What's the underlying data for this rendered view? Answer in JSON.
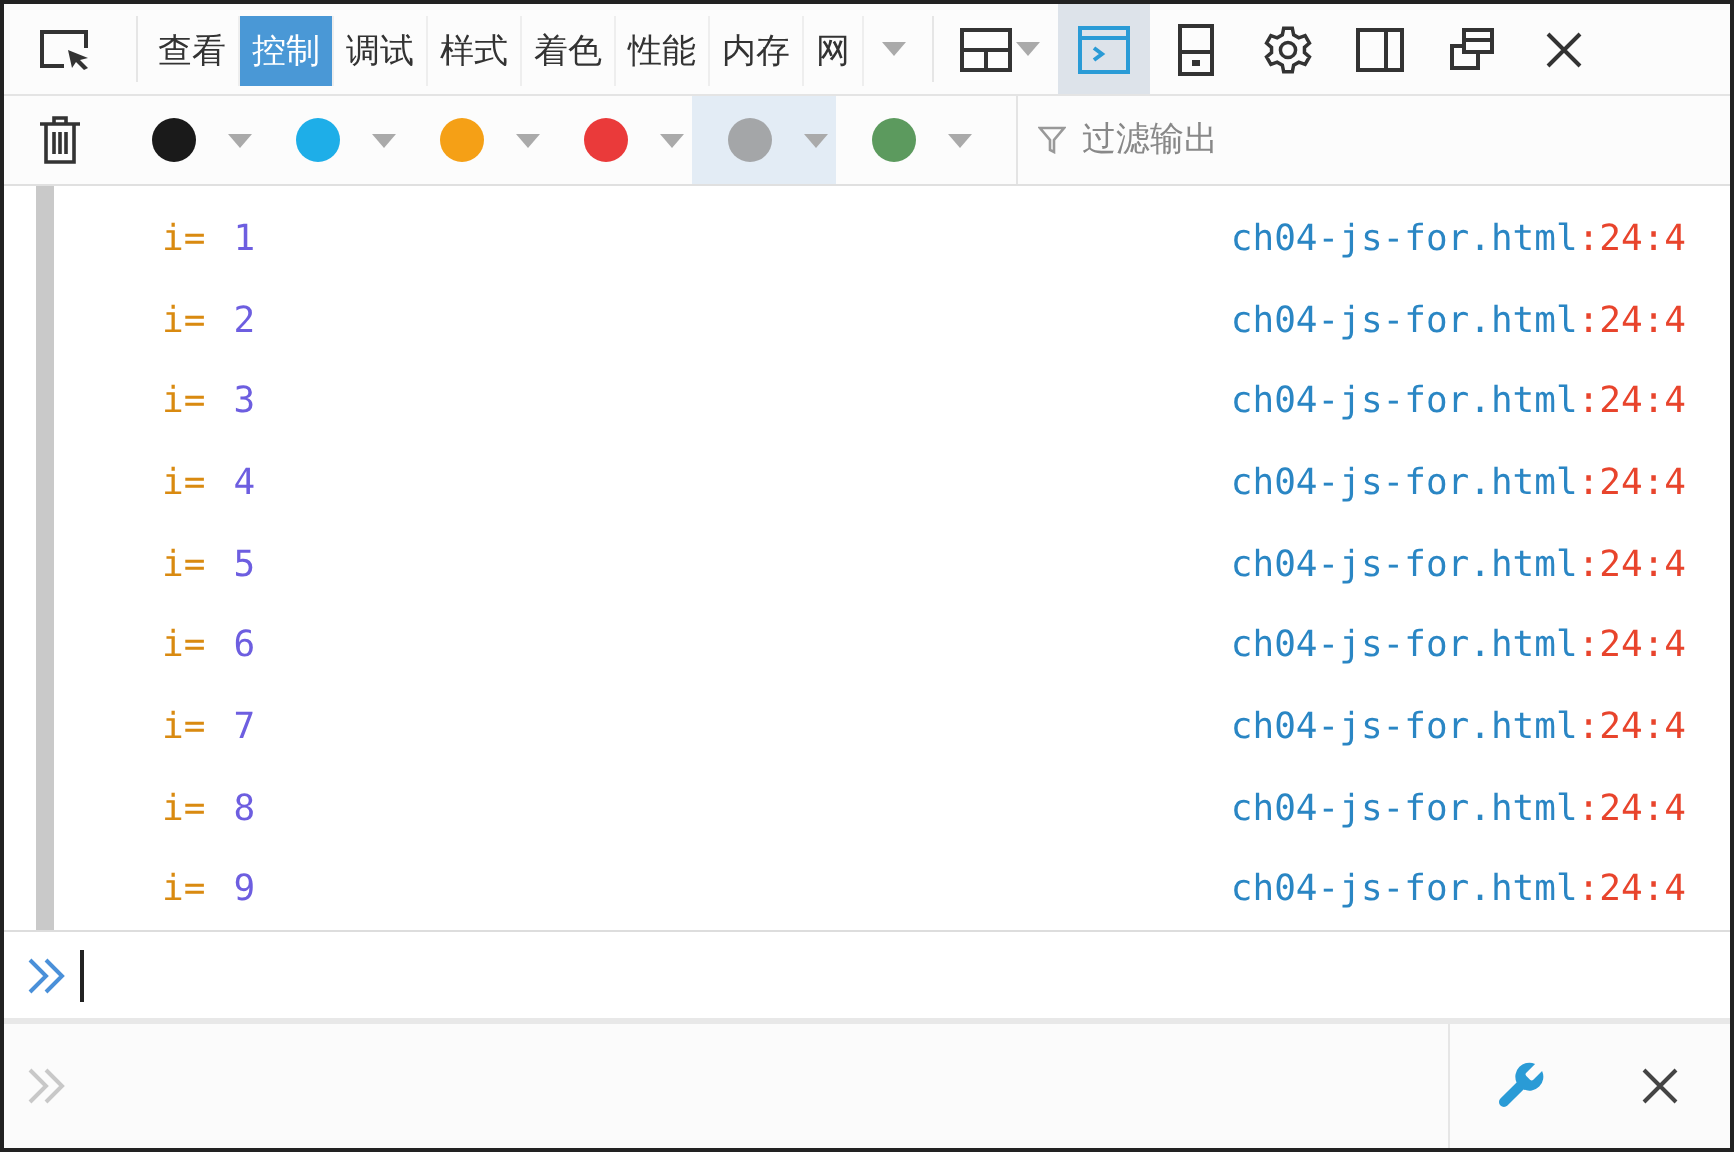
{
  "tabs": [
    {
      "label": "查看",
      "selected": false
    },
    {
      "label": "控制",
      "selected": true
    },
    {
      "label": "调试",
      "selected": false
    },
    {
      "label": "样式",
      "selected": false
    },
    {
      "label": "着色",
      "selected": false
    },
    {
      "label": "性能",
      "selected": false
    },
    {
      "label": "内存",
      "selected": false
    },
    {
      "label": "网",
      "selected": false
    }
  ],
  "toolbar_buttons": [
    {
      "kind": "layout",
      "selected": false
    },
    {
      "kind": "console",
      "selected": true
    },
    {
      "kind": "device",
      "selected": false
    },
    {
      "kind": "settings",
      "selected": false
    },
    {
      "kind": "dock",
      "selected": false
    },
    {
      "kind": "popout",
      "selected": false
    },
    {
      "kind": "close",
      "selected": false
    }
  ],
  "filters": [
    {
      "color": "#1a1a1a",
      "selected": false
    },
    {
      "color": "#1eaee8",
      "selected": false
    },
    {
      "color": "#f5a016",
      "selected": false
    },
    {
      "color": "#ea3a3a",
      "selected": false
    },
    {
      "color": "#a4a6a8",
      "selected": true
    },
    {
      "color": "#5c9a5e",
      "selected": false
    }
  ],
  "filter_placeholder": "过滤输出",
  "logs": [
    {
      "label": "i=",
      "value": "1",
      "source": "ch04-js-for.html",
      "location": ":24:4"
    },
    {
      "label": "i=",
      "value": "2",
      "source": "ch04-js-for.html",
      "location": ":24:4"
    },
    {
      "label": "i=",
      "value": "3",
      "source": "ch04-js-for.html",
      "location": ":24:4"
    },
    {
      "label": "i=",
      "value": "4",
      "source": "ch04-js-for.html",
      "location": ":24:4"
    },
    {
      "label": "i=",
      "value": "5",
      "source": "ch04-js-for.html",
      "location": ":24:4"
    },
    {
      "label": "i=",
      "value": "6",
      "source": "ch04-js-for.html",
      "location": ":24:4"
    },
    {
      "label": "i=",
      "value": "7",
      "source": "ch04-js-for.html",
      "location": ":24:4"
    },
    {
      "label": "i=",
      "value": "8",
      "source": "ch04-js-for.html",
      "location": ":24:4"
    },
    {
      "label": "i=",
      "value": "9",
      "source": "ch04-js-for.html",
      "location": ":24:4"
    }
  ]
}
